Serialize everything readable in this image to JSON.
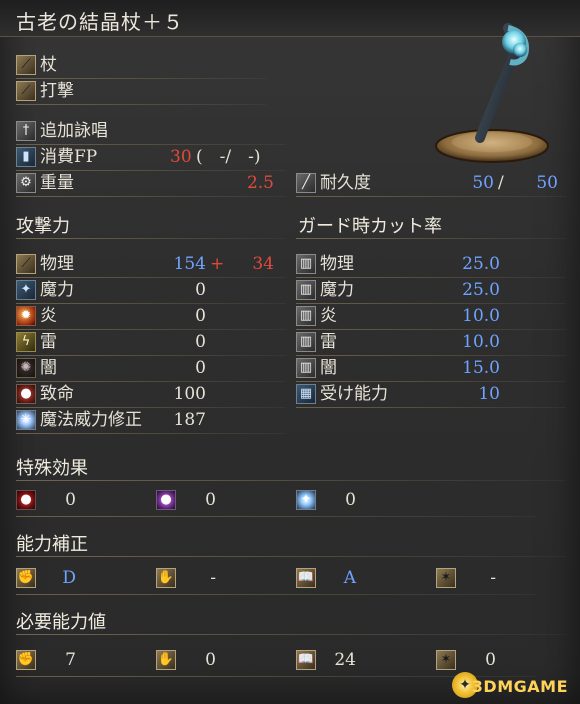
{
  "title": "古老の結晶杖＋５",
  "weapon_type": {
    "label": "杖",
    "attack_type": "打撃"
  },
  "skill": {
    "label": "追加詠唱"
  },
  "fp": {
    "label": "消費FP",
    "value": "30",
    "rest": "(　-/　-)"
  },
  "weight": {
    "label": "重量",
    "value": "2.5"
  },
  "durability": {
    "label": "耐久度",
    "current": "50",
    "sep": "/",
    "max": "50"
  },
  "attack": {
    "section": "攻撃力",
    "rows": [
      {
        "label": "物理",
        "value": "154",
        "plus": "+",
        "bonus": "34"
      },
      {
        "label": "魔力",
        "value": "0"
      },
      {
        "label": "炎",
        "value": "0"
      },
      {
        "label": "雷",
        "value": "0"
      },
      {
        "label": "闇",
        "value": "0"
      },
      {
        "label": "致命",
        "value": "100"
      },
      {
        "label": "魔法威力修正",
        "value": "187"
      }
    ]
  },
  "guard": {
    "section": "ガード時カット率",
    "rows": [
      {
        "label": "物理",
        "value": "25.0"
      },
      {
        "label": "魔力",
        "value": "25.0"
      },
      {
        "label": "炎",
        "value": "10.0"
      },
      {
        "label": "雷",
        "value": "10.0"
      },
      {
        "label": "闇",
        "value": "15.0"
      },
      {
        "label": "受け能力",
        "value": "10"
      }
    ]
  },
  "special": {
    "section": "特殊効果",
    "items": [
      {
        "icon": "bleed-icon",
        "value": "0"
      },
      {
        "icon": "poison-icon",
        "value": "0"
      },
      {
        "icon": "frost-icon",
        "value": "0"
      }
    ]
  },
  "scaling": {
    "section": "能力補正",
    "items": [
      {
        "icon": "strength-icon",
        "value": "D"
      },
      {
        "icon": "dexterity-icon",
        "value": "-"
      },
      {
        "icon": "intelligence-icon",
        "value": "A"
      },
      {
        "icon": "faith-icon",
        "value": "-"
      }
    ]
  },
  "requirements": {
    "section": "必要能力値",
    "items": [
      {
        "icon": "strength-icon",
        "value": "7"
      },
      {
        "icon": "dexterity-icon",
        "value": "0"
      },
      {
        "icon": "intelligence-icon",
        "value": "24"
      },
      {
        "icon": "faith-icon",
        "value": "0"
      }
    ]
  },
  "watermark": "3DMGAME",
  "colors": {
    "red": "#e04a3b",
    "blue": "#6fa3ff"
  }
}
